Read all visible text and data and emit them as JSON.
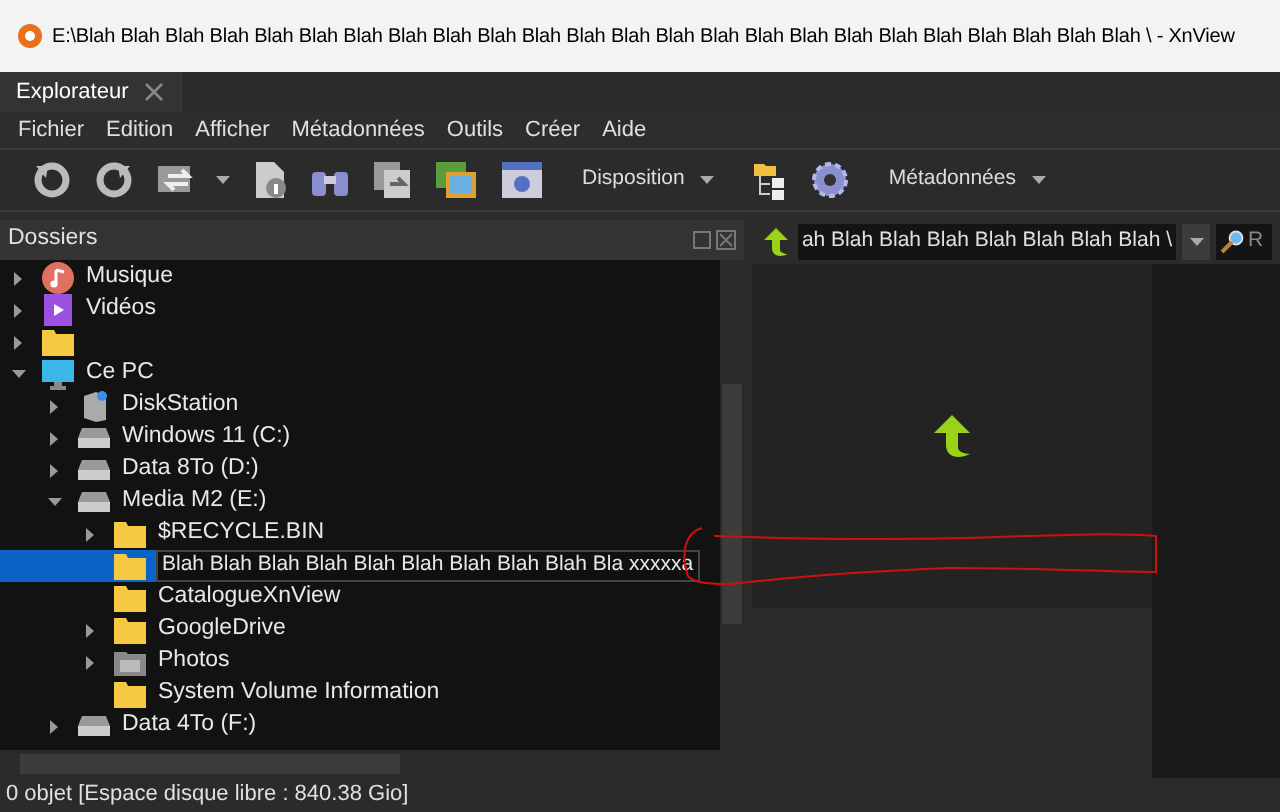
{
  "window": {
    "title": "E:\\Blah Blah Blah Blah Blah Blah Blah Blah Blah Blah Blah Blah Blah Blah Blah Blah Blah Blah Blah Blah Blah Blah Blah Blah \\ - XnView"
  },
  "tabs": [
    {
      "label": "Explorateur",
      "selected": true
    }
  ],
  "menu": [
    "Fichier",
    "Edition",
    "Afficher",
    "Métadonnées",
    "Outils",
    "Créer",
    "Aide"
  ],
  "toolbar": [
    "Disposition",
    "Métadonnées"
  ],
  "folders_panel": {
    "title": "Dossiers",
    "tree": [
      {
        "label": "Musique",
        "kind": "music",
        "expanded": false
      },
      {
        "label": "Vidéos",
        "kind": "video",
        "expanded": false
      },
      {
        "kind": "folder",
        "expanded": false
      },
      {
        "label": "Ce PC",
        "kind": "pc",
        "expanded": true,
        "children": [
          {
            "label": "DiskStation",
            "kind": "nas",
            "expanded": false
          },
          {
            "label": "Windows 11 (C:)",
            "kind": "drive",
            "expanded": false
          },
          {
            "label": "Data 8To (D:)",
            "kind": "drive",
            "expanded": false
          },
          {
            "label": "Media M2 (E:)",
            "kind": "drive",
            "expanded": true,
            "children": [
              {
                "label": "$RECYCLE.BIN",
                "kind": "folder",
                "expanded": false
              },
              {
                "label": "Blah Blah Blah Blah Blah Blah Blah Blah Blah Bla xxxxxa",
                "kind": "folder",
                "selected": true,
                "editing": true
              },
              {
                "label": "CatalogueXnView",
                "kind": "folder",
                "selected": false
              },
              {
                "label": "GoogleDrive",
                "kind": "folder",
                "expanded": false
              },
              {
                "label": "Photos",
                "kind": "photos",
                "expanded": false
              },
              {
                "label": "System Volume Information",
                "kind": "folder",
                "selected": false
              }
            ]
          },
          {
            "label": "Data 4To (F:)",
            "kind": "drive",
            "expanded": false
          }
        ]
      }
    ]
  },
  "path_bar": {
    "value": "ah Blah Blah Blah Blah Blah Blah Blah \\",
    "search_label": "R"
  },
  "status_bar": "0 objet [Espace disque libre : 840.38 Gio]"
}
